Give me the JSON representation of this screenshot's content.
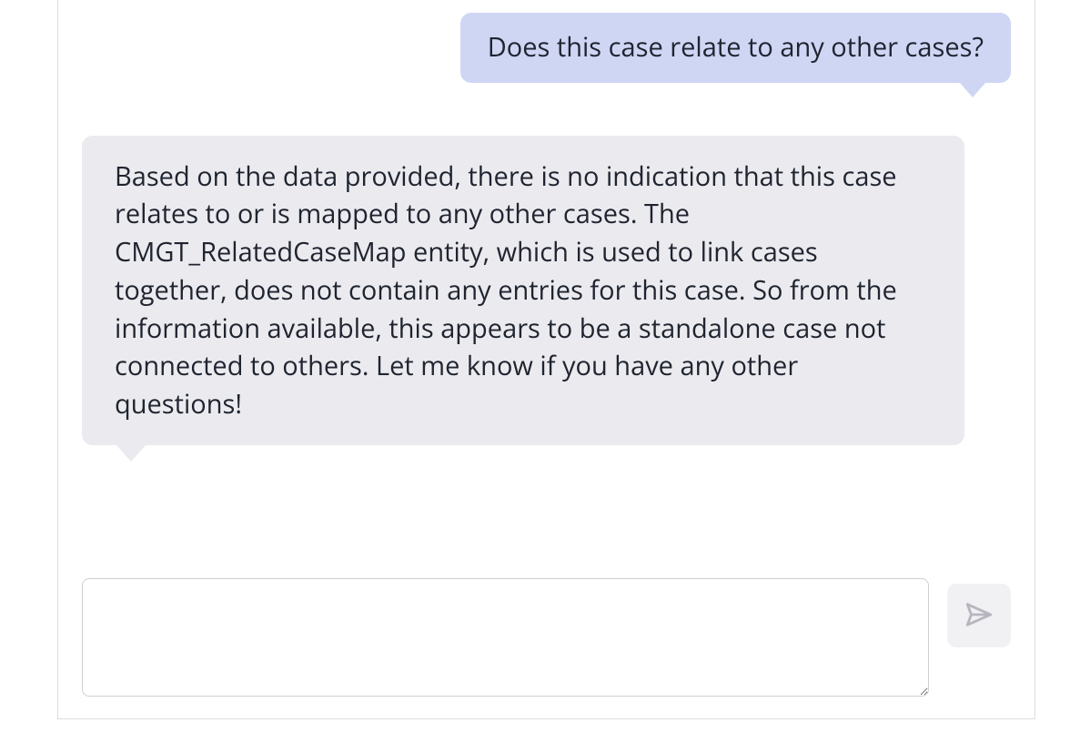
{
  "colors": {
    "user_bubble_bg": "#cfd6f4",
    "assistant_bubble_bg": "#ebebef",
    "panel_border": "#dcdcdc",
    "send_btn_bg": "#f1f1f3",
    "send_icon": "#b6b6be",
    "text": "#1f2430"
  },
  "messages": {
    "user_1": "Does this case relate to any other cases?",
    "assistant_1": "Based on the data provided, there is no indication that this case relates to or is mapped to any other cases. The CMGT_RelatedCaseMap entity, which is used to link cases together, does not contain any entries for this case. So from the information available, this appears to be a standalone case not connected to others. Let me know if you have any other questions!"
  },
  "composer": {
    "value": "",
    "placeholder": ""
  },
  "icons": {
    "send": "paper-plane-icon"
  }
}
